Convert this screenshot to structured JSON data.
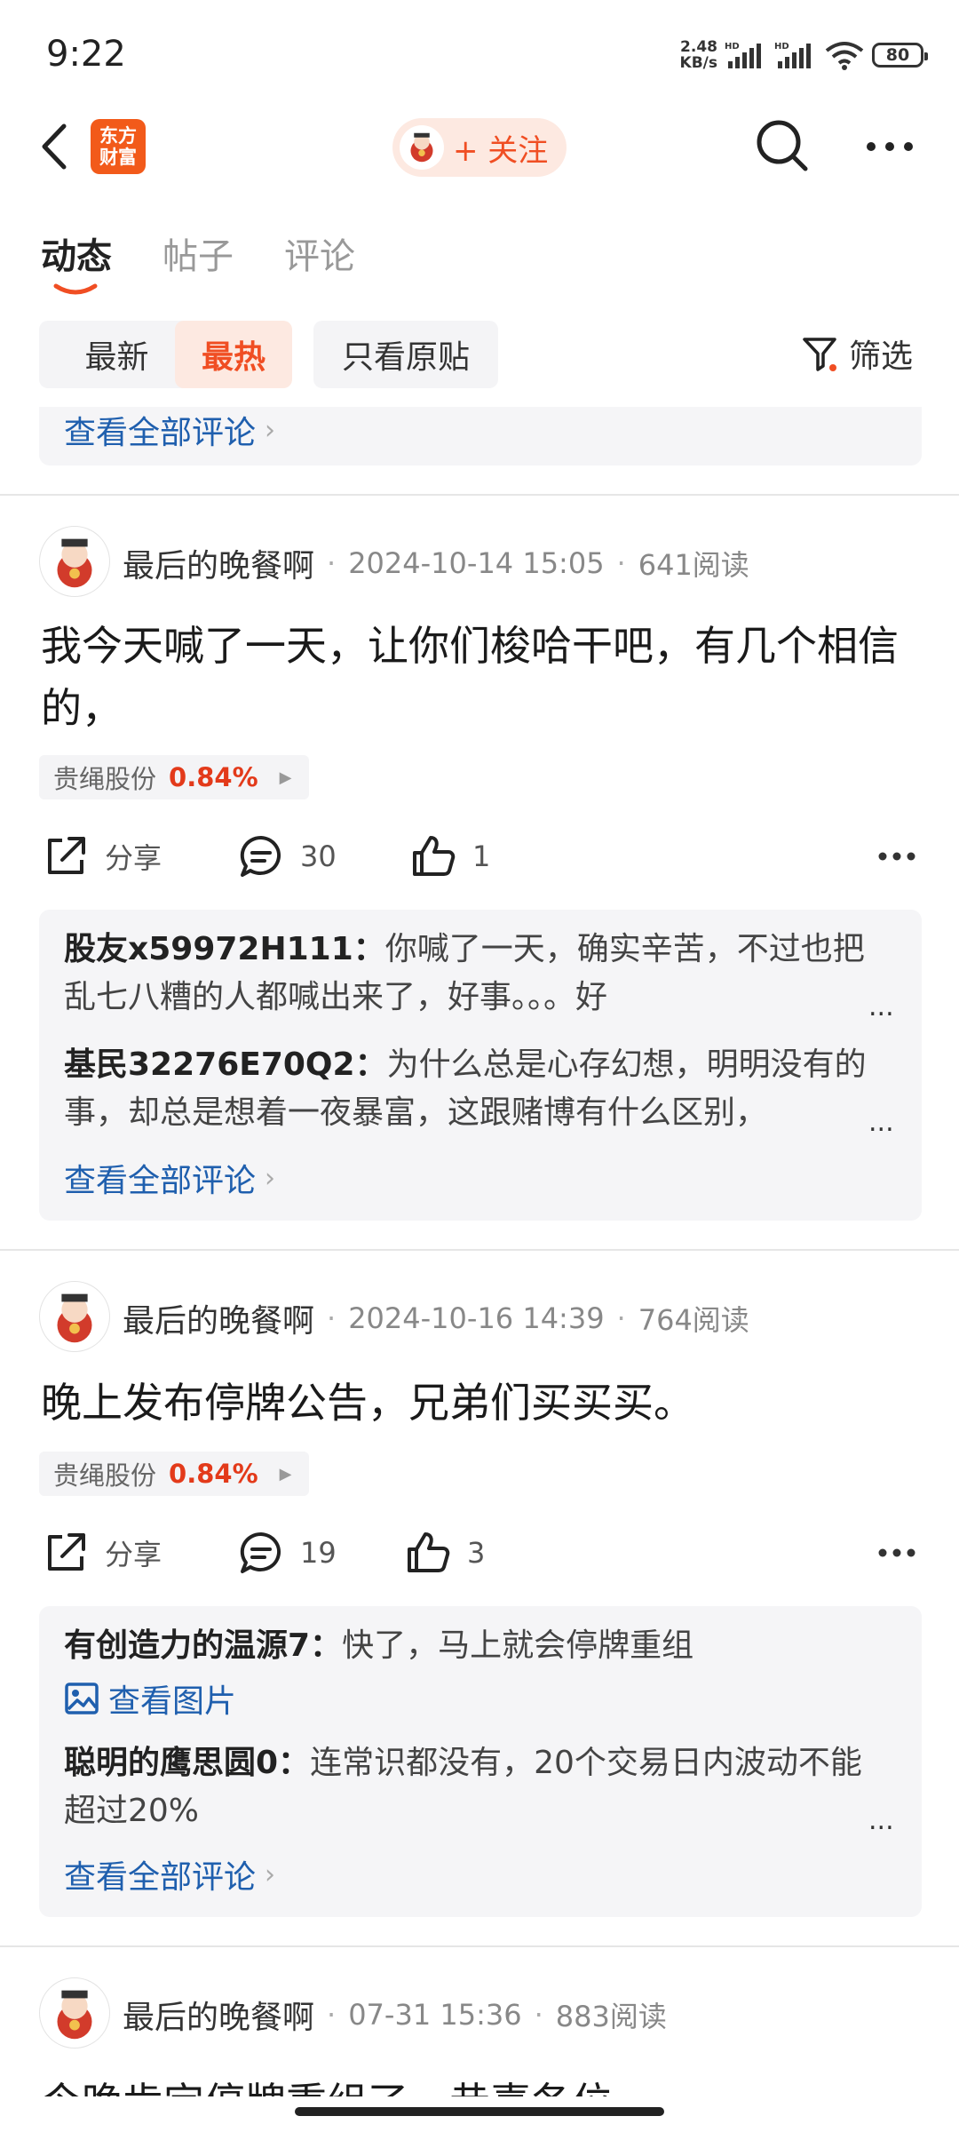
{
  "status_bar": {
    "time": "9:22",
    "net_speed_line1": "2.48",
    "net_speed_line2": "KB/s",
    "battery": "80"
  },
  "header": {
    "logo_line1": "东方",
    "logo_line2": "财富",
    "follow_label": "+ 关注"
  },
  "tabs": [
    {
      "label": "动态",
      "active": true
    },
    {
      "label": "帖子"
    },
    {
      "label": "评论"
    }
  ],
  "filters": {
    "chips": [
      {
        "label": "最新"
      },
      {
        "label": "最热",
        "active": true
      },
      {
        "label": "只看原贴"
      }
    ],
    "filter_label": "筛选"
  },
  "top_partial": {
    "see_all": "查看全部评论"
  },
  "posts": [
    {
      "user": "最后的晚餐啊",
      "time": "2024-10-14 15:05",
      "reads": "641阅读",
      "text": "我今天喊了一天，让你们梭哈干吧，有几个相信的，",
      "stock": {
        "name": "贵绳股份",
        "change": "0.84%"
      },
      "share": "分享",
      "comments": "30",
      "likes": "1",
      "replies": [
        {
          "author": "股友x59972H111：",
          "text": "你喊了一天，确实辛苦，不过也把乱七八糟的人都喊出来了，好事。。。好"
        },
        {
          "author": "基民32276E70Q2：",
          "text": "为什么总是心存幻想，明明没有的事，却总是想着一夜暴富，这跟赌博有什么区别，"
        }
      ],
      "see_all": "查看全部评论"
    },
    {
      "user": "最后的晚餐啊",
      "time": "2024-10-16 14:39",
      "reads": "764阅读",
      "text": "晚上发布停牌公告，兄弟们买买买。",
      "stock": {
        "name": "贵绳股份",
        "change": "0.84%"
      },
      "share": "分享",
      "comments": "19",
      "likes": "3",
      "replies": [
        {
          "author": "有创造力的温源7：",
          "text": "快了，马上就会停牌重组",
          "image_link": "查看图片"
        },
        {
          "author": "聪明的鹰思圆0：",
          "text": "连常识都没有，20个交易日内波动不能超过20%"
        }
      ],
      "see_all": "查看全部评论"
    },
    {
      "user": "最后的晚餐啊",
      "time": "07-31 15:36",
      "reads": "883阅读",
      "text": "今晚肯定停牌重组了，恭喜各位"
    }
  ],
  "colors": {
    "accent": "#f04e23",
    "link": "#1f5fae",
    "stock_up": "#e33a1a"
  }
}
